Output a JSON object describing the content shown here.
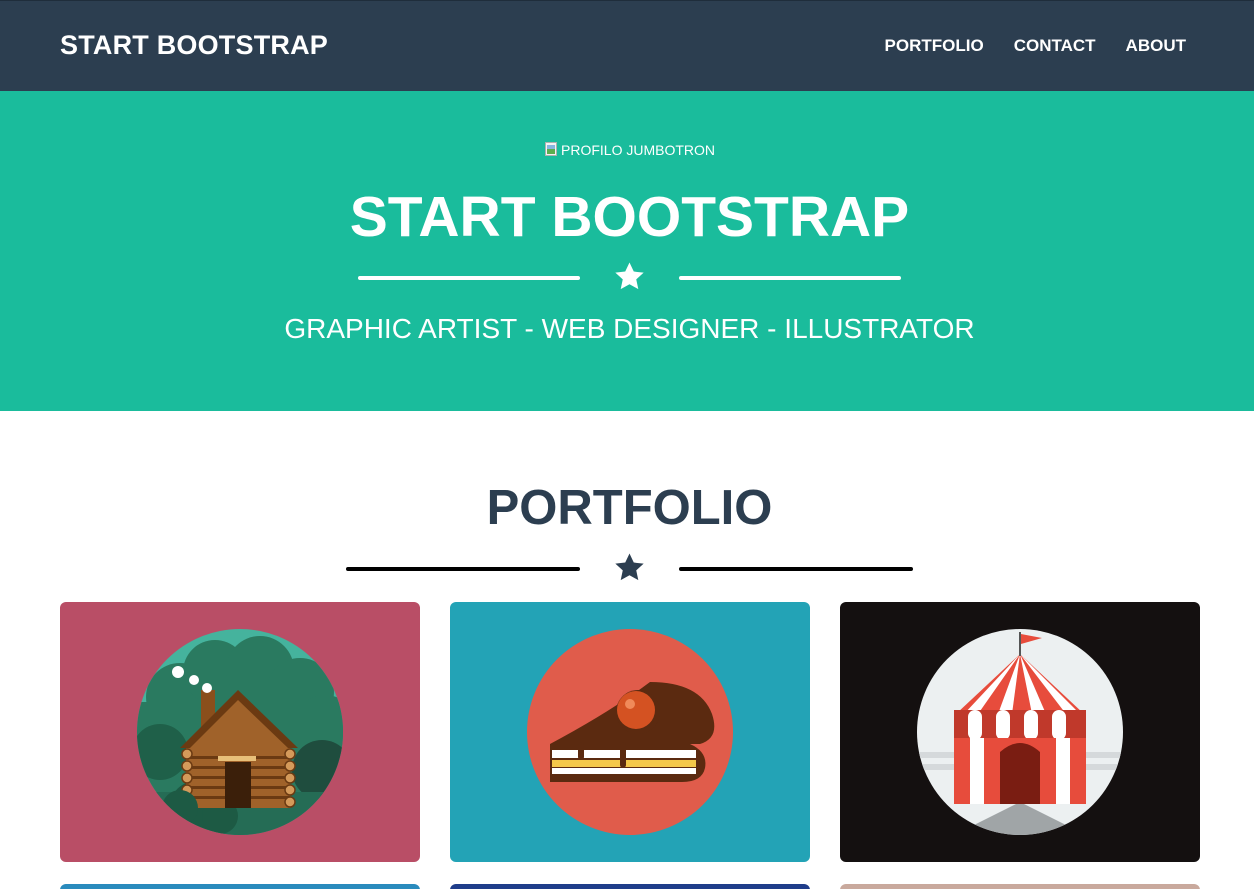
{
  "navbar": {
    "brand": "START BOOTSTRAP",
    "links": [
      "PORTFOLIO",
      "CONTACT",
      "ABOUT"
    ]
  },
  "header": {
    "image_alt": "PROFILO JUMBOTRON",
    "title": "START BOOTSTRAP",
    "subtitle": "GRAPHIC ARTIST - WEB DESIGNER - ILLUSTRATOR",
    "divider_icon": "star-icon"
  },
  "portfolio": {
    "title": "PORTFOLIO",
    "divider_icon": "star-icon",
    "items": [
      {
        "icon": "cabin-icon",
        "bg": "#b94e66"
      },
      {
        "icon": "cake-icon",
        "bg": "#23a3b6"
      },
      {
        "icon": "circus-tent-icon",
        "bg": "#141010"
      },
      {
        "icon": "",
        "bg": "#2a8bbd"
      },
      {
        "icon": "",
        "bg": "#1f3d8a"
      },
      {
        "icon": "",
        "bg": "#c9a99d"
      }
    ]
  },
  "colors": {
    "navbar": "#2c3e50",
    "primary": "#1abc9c",
    "text": "#2c3e50",
    "white": "#ffffff"
  }
}
